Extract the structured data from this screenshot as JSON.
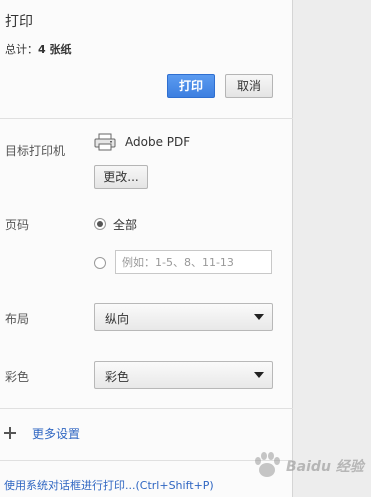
{
  "header": {
    "title": "打印",
    "total_label": "总计：",
    "total_value": "4 张纸"
  },
  "actions": {
    "print_label": "打印",
    "cancel_label": "取消"
  },
  "destination": {
    "label": "目标打印机",
    "printer_name": "Adobe PDF",
    "change_label": "更改..."
  },
  "pages": {
    "label": "页码",
    "all_label": "全部",
    "custom_placeholder": "例如：1-5、8、11-13",
    "selected": "all"
  },
  "layout": {
    "label": "布局",
    "value": "纵向"
  },
  "color": {
    "label": "彩色",
    "value": "彩色"
  },
  "more_settings": {
    "label": "更多设置"
  },
  "system_dialog": {
    "label": "使用系统对话框进行打印...(Ctrl+Shift+P)"
  },
  "watermark": {
    "text": "Baidu 经验"
  },
  "colors": {
    "accent": "#3d7fe0",
    "link": "#2f66c2"
  }
}
